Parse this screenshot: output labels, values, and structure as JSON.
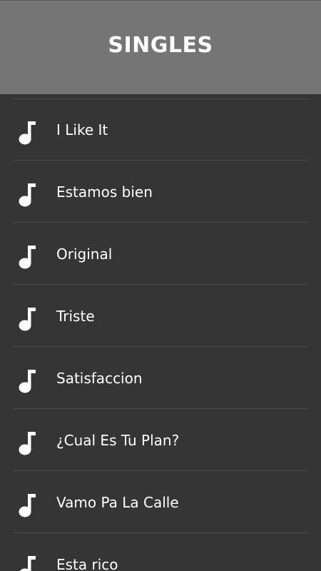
{
  "header": {
    "title": "SINGLES"
  },
  "songs": [
    {
      "title": "I Like It"
    },
    {
      "title": "Estamos bien"
    },
    {
      "title": "Original"
    },
    {
      "title": "Triste"
    },
    {
      "title": "Satisfaccion"
    },
    {
      "title": "¿Cual Es Tu Plan?"
    },
    {
      "title": "Vamo Pa La Calle"
    },
    {
      "title": "Esta rico"
    }
  ],
  "icons": {
    "song": "music-note-icon"
  },
  "colors": {
    "header_bg": "#757575",
    "list_bg": "#353535",
    "text": "#ffffff"
  }
}
